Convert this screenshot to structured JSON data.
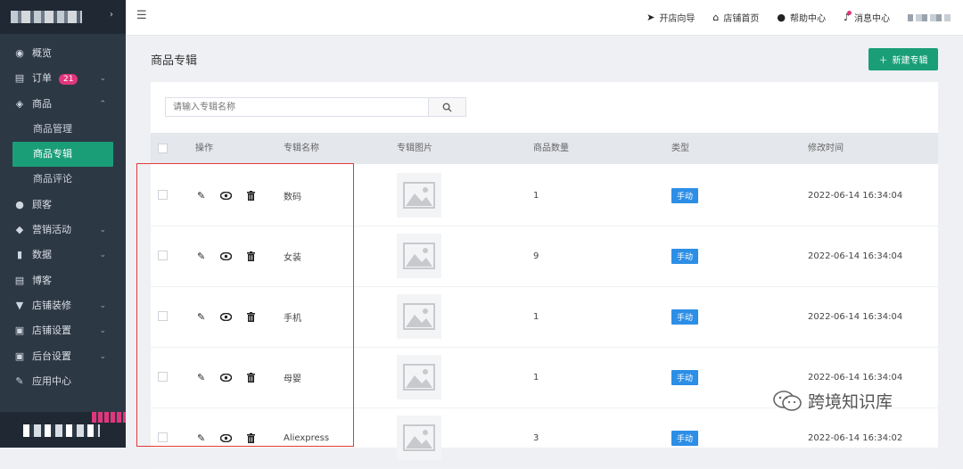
{
  "sidebar": {
    "items": [
      {
        "label": "概览",
        "icon": "dashboard-icon",
        "glyph": "◉",
        "arrow": ""
      },
      {
        "label": "订单",
        "icon": "clipboard-icon",
        "glyph": "▤",
        "arrow": "⌄",
        "badge": "21"
      },
      {
        "label": "商品",
        "icon": "box-icon",
        "glyph": "◈",
        "arrow": "⌃"
      },
      {
        "label": "商品管理",
        "sub": true
      },
      {
        "label": "商品专辑",
        "sub": true,
        "active": true
      },
      {
        "label": "商品评论",
        "sub": true
      },
      {
        "label": "顾客",
        "icon": "user-icon",
        "glyph": "●",
        "arrow": ""
      },
      {
        "label": "营销活动",
        "icon": "tag-icon",
        "glyph": "◆",
        "arrow": "⌄"
      },
      {
        "label": "数据",
        "icon": "bar-chart-icon",
        "glyph": "▮",
        "arrow": "⌄"
      },
      {
        "label": "博客",
        "icon": "document-icon",
        "glyph": "▤",
        "arrow": ""
      },
      {
        "label": "店铺装修",
        "icon": "paint-roller-icon",
        "glyph": "▼",
        "arrow": "⌄"
      },
      {
        "label": "店铺设置",
        "icon": "store-icon",
        "glyph": "▣",
        "arrow": "⌄"
      },
      {
        "label": "后台设置",
        "icon": "monitor-icon",
        "glyph": "▣",
        "arrow": "⌄"
      },
      {
        "label": "应用中心",
        "icon": "wrench-icon",
        "glyph": "✎",
        "arrow": ""
      }
    ]
  },
  "topbar": {
    "items": [
      {
        "label": "开店向导",
        "icon": "send-icon",
        "glyph": "➤"
      },
      {
        "label": "店铺首页",
        "icon": "home-icon",
        "glyph": "⌂"
      },
      {
        "label": "帮助中心",
        "icon": "help-icon",
        "glyph": "❓"
      },
      {
        "label": "消息中心",
        "icon": "bell-icon",
        "glyph": "🔔"
      }
    ]
  },
  "page": {
    "title": "商品专辑",
    "new_button": "新建专辑",
    "search_placeholder": "请输入专辑名称"
  },
  "table": {
    "headers": [
      "操作",
      "专辑名称",
      "专辑图片",
      "商品数量",
      "类型",
      "修改时间"
    ],
    "rows": [
      {
        "name": "数码",
        "count": "1",
        "type": "手动",
        "time": "2022-06-14 16:34:04"
      },
      {
        "name": "女装",
        "count": "9",
        "type": "手动",
        "time": "2022-06-14 16:34:04"
      },
      {
        "name": "手机",
        "count": "1",
        "type": "手动",
        "time": "2022-06-14 16:34:04"
      },
      {
        "name": "母婴",
        "count": "1",
        "type": "手动",
        "time": "2022-06-14 16:34:04"
      },
      {
        "name": "Aliexpress",
        "count": "3",
        "type": "手动",
        "time": "2022-06-14 16:34:02"
      }
    ]
  },
  "watermark": "跨境知识库",
  "colors": {
    "primary": "#1a9e78",
    "sidebar": "#2d3845",
    "tag": "#2d8ee6",
    "badge": "#e0367b",
    "highlight": "#e4393c"
  }
}
